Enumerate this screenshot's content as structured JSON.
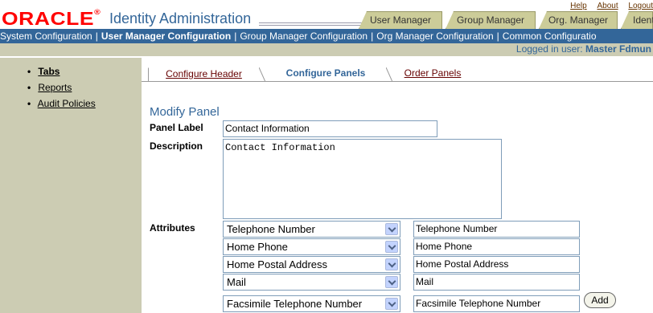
{
  "header": {
    "logo_text": "ORACLE",
    "logo_reg": "®",
    "app_title": "Identity Administration",
    "global_links": [
      "Help",
      "About",
      "Logout"
    ],
    "tabs": [
      "User Manager",
      "Group Manager",
      "Org. Manager",
      "Identi"
    ]
  },
  "subnav": {
    "items": [
      "System Configuration",
      "User Manager Configuration",
      "Group Manager Configuration",
      "Org Manager Configuration",
      "Common Configuratio"
    ],
    "separator": "|",
    "selected_index": 1
  },
  "logged_in": {
    "prefix": "Logged in user:",
    "user": "Master Fdmun"
  },
  "leftnav": {
    "items": [
      "Tabs",
      "Reports",
      "Audit Policies"
    ],
    "bullet": "•",
    "selected_index": 0
  },
  "content_tabs": [
    "Configure Header",
    "Configure Panels",
    "Order Panels"
  ],
  "form": {
    "title": "Modify Panel",
    "panel_label_label": "Panel Label",
    "panel_label_value": "Contact Information",
    "description_label": "Description",
    "description_value": "Contact Information",
    "attributes_label": "Attributes",
    "attributes": [
      {
        "select": "Telephone Number",
        "label": "Telephone Number"
      },
      {
        "select": "Home Phone",
        "label": "Home Phone"
      },
      {
        "select": "Home Postal Address",
        "label": "Home Postal Address"
      },
      {
        "select": "Mail",
        "label": "Mail"
      },
      {
        "select": "Facsimile Telephone Number",
        "label": "Facsimile Telephone Number"
      }
    ],
    "add_label": "Add"
  },
  "colors": {
    "brand_red": "#ff0000",
    "nav_blue": "#336699",
    "side_tan": "#ccccb3",
    "tab_tan": "#cccc99"
  }
}
